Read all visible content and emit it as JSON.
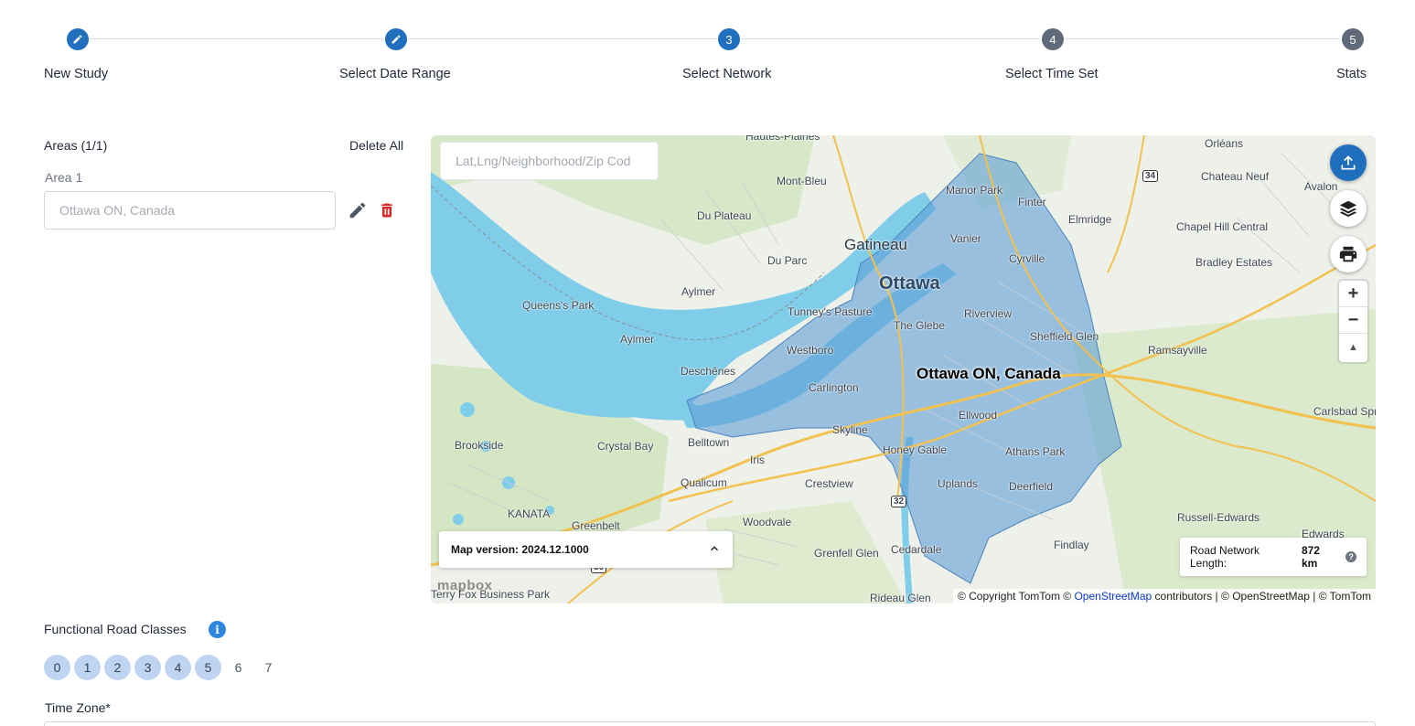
{
  "stepper": {
    "steps": [
      {
        "label": "New Study",
        "marker": "",
        "state": "done"
      },
      {
        "label": "Select Date Range",
        "marker": "",
        "state": "done"
      },
      {
        "label": "Select Network",
        "marker": "3",
        "state": "active"
      },
      {
        "label": "Select Time Set",
        "marker": "4",
        "state": "pending"
      },
      {
        "label": "Stats",
        "marker": "5",
        "state": "pending"
      }
    ]
  },
  "areas": {
    "title": "Areas (1/1)",
    "delete_all_label": "Delete All",
    "items": [
      {
        "label": "Area 1",
        "placeholder": "Ottawa ON, Canada"
      }
    ]
  },
  "map": {
    "search_placeholder": "Lat,Lng/Neighborhood/Zip Cod",
    "area_label": "Ottawa ON, Canada",
    "version_label": "Map version: 2024.12.1000",
    "road_network_label": "Road Network Length:",
    "road_network_value": "872 km",
    "attribution_prefix": "© Copyright TomTom ©",
    "attribution_link": "OpenStreetMap",
    "attribution_suffix": "contributors | © OpenStreetMap | © TomTom",
    "logo_text": "mapbox",
    "zoom_in": "+",
    "zoom_out": "−",
    "compass": "▲",
    "place_labels": {
      "hautes_plaines": "Hautes-Plaines",
      "orleans": "Orléans",
      "mont_bleu": "Mont-Bleu",
      "manor_park": "Manor Park",
      "finter": "Finter",
      "chateau_neuf": "Chateau Neuf",
      "avalon": "Avalon",
      "du_plateau": "Du Plateau",
      "elmridge": "Elmridge",
      "chapel_hill": "Chapel Hill Central",
      "gatineau": "Gatineau",
      "vanier": "Vanier",
      "du_parc": "Du Parc",
      "cyrville": "Cyrville",
      "bradley": "Bradley Estates",
      "ottawa": "Ottawa",
      "aylmer_n": "Aylmer",
      "queens_park": "Queens's Park",
      "tunneys": "Tunney's Pasture",
      "glebe": "The Glebe",
      "riverview": "Riverview",
      "aylmer_s": "Aylmer",
      "sheffield": "Sheffield Glen",
      "westboro": "Westboro",
      "ramsayville": "Ramsayville",
      "deschenes": "Deschênes",
      "carlington": "Carlington",
      "ellwood": "Ellwood",
      "carlsbad": "Carlsbad Sprin",
      "skyline": "Skyline",
      "brookside": "Brookside",
      "crystal_bay": "Crystal Bay",
      "belltown": "Belltown",
      "honey_gable": "Honey Gable",
      "athans_park": "Athans Park",
      "iris": "Iris",
      "qualicum": "Qualicum",
      "crestview": "Crestview",
      "uplands": "Uplands",
      "deerfield": "Deerfield",
      "kanata": "KANATA",
      "greenbelt": "Greenbelt",
      "woodvale": "Woodvale",
      "russell": "Russell-Edwards",
      "edwards": "Edwards",
      "findlay": "Findlay",
      "grenfell": "Grenfell Glen",
      "cedardale": "Cedardale",
      "terry_fox": "Terry Fox Business Park",
      "rideau_glen": "Rideau Glen",
      "hwy34": "34",
      "hwy32": "32",
      "hwy36": "36"
    }
  },
  "frc": {
    "title": "Functional Road Classes",
    "info_glyph": "i",
    "classes": [
      {
        "label": "0",
        "selected": true
      },
      {
        "label": "1",
        "selected": true
      },
      {
        "label": "2",
        "selected": true
      },
      {
        "label": "3",
        "selected": true
      },
      {
        "label": "4",
        "selected": true
      },
      {
        "label": "5",
        "selected": true
      },
      {
        "label": "6",
        "selected": false
      },
      {
        "label": "7",
        "selected": false
      }
    ]
  },
  "timezone": {
    "label": "Time Zone*"
  },
  "colors": {
    "primary": "#1f6fbd",
    "pending_step": "#5f6b7a",
    "chip_selected": "#bfd4f1",
    "delete_red": "#dc2626",
    "water": "#7fcde9",
    "area_fill": "#5f9ed6"
  },
  "icons": {
    "completed_step": "pencil-icon",
    "edit": "pencil-icon",
    "delete": "trash-icon",
    "upload": "upload-icon",
    "layers": "layers-icon",
    "print": "printer-icon",
    "collapse": "chevron-up-icon",
    "help": "help-icon",
    "info": "info-icon"
  }
}
